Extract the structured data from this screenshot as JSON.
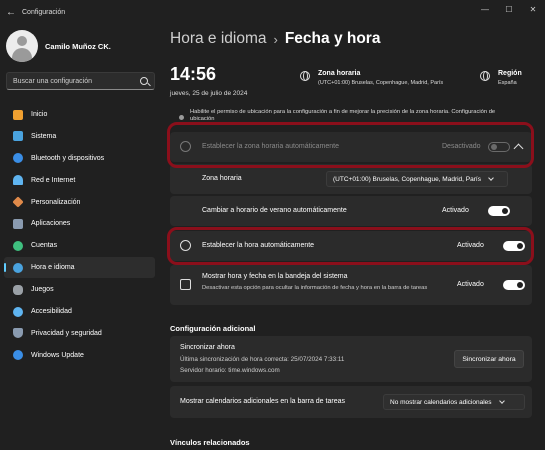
{
  "app": {
    "title": "Configuración"
  },
  "window_controls": {
    "minimize": "—",
    "maximize": "☐",
    "close": "✕"
  },
  "user": {
    "name": "Camilo Muñoz CK."
  },
  "search": {
    "placeholder": "Buscar una configuración"
  },
  "sidebar": {
    "items": [
      {
        "label": "Inicio",
        "icon": "home-icon",
        "color": "#f0a030"
      },
      {
        "label": "Sistema",
        "icon": "monitor-icon",
        "color": "#4aa3df"
      },
      {
        "label": "Bluetooth y dispositivos",
        "icon": "bluetooth-icon",
        "color": "#3a8ee6"
      },
      {
        "label": "Red e Internet",
        "icon": "wifi-icon",
        "color": "#5fb4f0"
      },
      {
        "label": "Personalización",
        "icon": "brush-icon",
        "color": "#e08a4a"
      },
      {
        "label": "Aplicaciones",
        "icon": "apps-icon",
        "color": "#8a9bb0"
      },
      {
        "label": "Cuentas",
        "icon": "person-icon",
        "color": "#3fbf7f"
      },
      {
        "label": "Hora e idioma",
        "icon": "globe-clock-icon",
        "color": "#4aa3df",
        "active": true
      },
      {
        "label": "Juegos",
        "icon": "gamepad-icon",
        "color": "#9aa0a6"
      },
      {
        "label": "Accesibilidad",
        "icon": "accessibility-icon",
        "color": "#5fb4f0"
      },
      {
        "label": "Privacidad y seguridad",
        "icon": "shield-icon",
        "color": "#8a9bb0"
      },
      {
        "label": "Windows Update",
        "icon": "update-icon",
        "color": "#3a8ee6"
      }
    ]
  },
  "breadcrumb": {
    "parent": "Hora e idioma",
    "separator": "›",
    "current": "Fecha y hora"
  },
  "clock": {
    "time": "14:56",
    "date": "jueves, 25 de julio de 2024"
  },
  "timezone_block": {
    "title": "Zona horaria",
    "value": "(UTC+01:00) Bruselas, Copenhague, Madrid, París"
  },
  "region_block": {
    "title": "Región",
    "value": "España"
  },
  "location_note": "Habilite el permiso de ubicación para la configuración a fin de mejorar la precisión de la zona horaria. Configuración de ubicación",
  "auto_timezone": {
    "label": "Establecer la zona horaria automáticamente",
    "status": "Desactivado",
    "on": false
  },
  "timezone_row": {
    "label": "Zona horaria",
    "value": "(UTC+01:00) Bruselas, Copenhague, Madrid, París"
  },
  "dst_row": {
    "label": "Cambiar a horario de verano automáticamente",
    "status": "Activado",
    "on": true
  },
  "auto_time": {
    "label": "Establecer la hora automáticamente",
    "status": "Activado",
    "on": true
  },
  "tray_row": {
    "label": "Mostrar hora y fecha en la bandeja del sistema",
    "sub": "Desactivar esta opción para ocultar la información de fecha y hora en la barra de tareas",
    "status": "Activado",
    "on": true
  },
  "additional": {
    "title": "Configuración adicional",
    "sync_title": "Sincronizar ahora",
    "sync_last": "Última sincronización de hora correcta: 25/07/2024 7:33:11",
    "sync_server": "Servidor horario: time.windows.com",
    "sync_button": "Sincronizar ahora",
    "calendars_label": "Mostrar calendarios adicionales en la barra de tareas",
    "calendars_value": "No mostrar calendarios adicionales"
  },
  "related": {
    "title": "Vínculos relacionados"
  },
  "colors": {
    "accent": "#60cdff",
    "highlight_border": "#8b0f1b",
    "background": "#202020",
    "card": "#2b2b2b"
  }
}
